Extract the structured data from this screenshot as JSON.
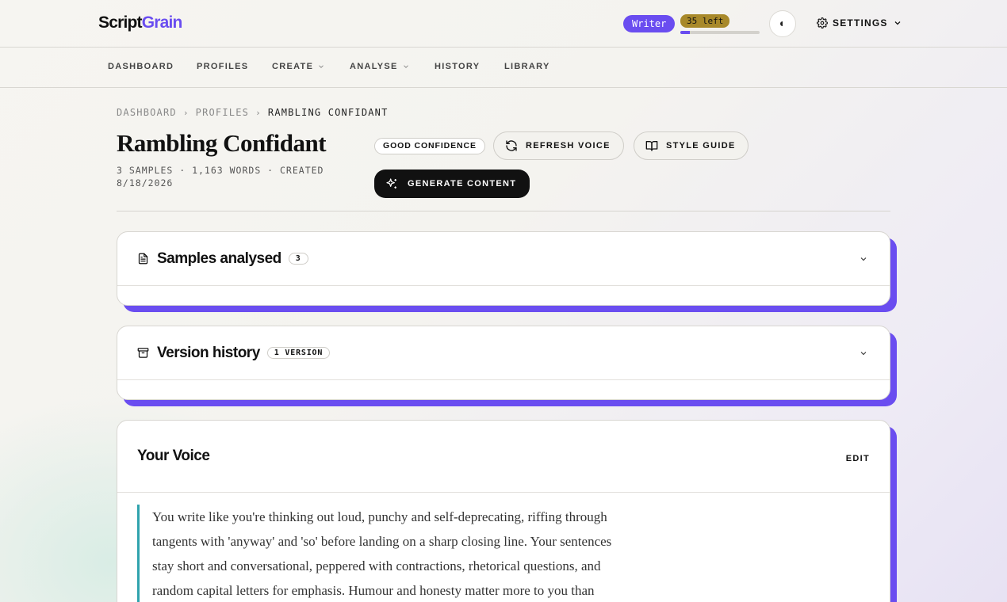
{
  "brand": {
    "part1": "Script",
    "part2": "Grain"
  },
  "header": {
    "plan_badge": "Writer",
    "usage_badge": "35 left",
    "usage_fraction": 0.12,
    "settings_label": "SETTINGS"
  },
  "nav": {
    "dashboard": "DASHBOARD",
    "profiles": "PROFILES",
    "create": "CREATE",
    "analyse": "ANALYSE",
    "history": "HISTORY",
    "library": "LIBRARY"
  },
  "breadcrumb": {
    "item1": "DASHBOARD",
    "item2": "PROFILES",
    "current": "RAMBLING CONFIDANT"
  },
  "profile": {
    "title": "Rambling Confidant",
    "meta": "3 SAMPLES · 1,163 WORDS · CREATED 8/18/2026",
    "confidence": "GOOD CONFIDENCE",
    "refresh_label": "REFRESH VOICE",
    "style_guide_label": "STYLE GUIDE",
    "generate_label": "GENERATE CONTENT"
  },
  "samples_card": {
    "title": "Samples analysed",
    "count": "3"
  },
  "versions_card": {
    "title": "Version history",
    "count": "1 VERSION"
  },
  "voice_card": {
    "title": "Your Voice",
    "edit_label": "EDIT",
    "body": "You write like you're thinking out loud, punchy and self-deprecating, riffing through tangents with 'anyway' and 'so' before landing on a sharp closing line. Your sentences stay short and conversational, peppered with contractions, rhetorical questions, and random capital letters for emphasis. Humour and honesty matter more to you than"
  },
  "colors": {
    "accent": "#6a4df0",
    "quote_bar": "#2fa3ad",
    "usage_badge": "#a8892a"
  }
}
